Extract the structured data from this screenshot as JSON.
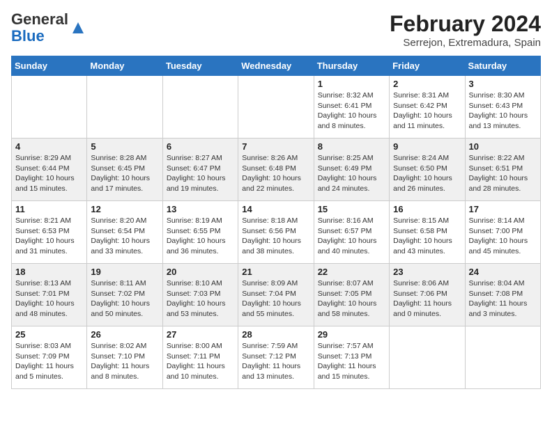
{
  "header": {
    "logo_general": "General",
    "logo_blue": "Blue",
    "month_year": "February 2024",
    "location": "Serrejon, Extremadura, Spain"
  },
  "columns": [
    "Sunday",
    "Monday",
    "Tuesday",
    "Wednesday",
    "Thursday",
    "Friday",
    "Saturday"
  ],
  "weeks": [
    [
      {
        "day": "",
        "info": ""
      },
      {
        "day": "",
        "info": ""
      },
      {
        "day": "",
        "info": ""
      },
      {
        "day": "",
        "info": ""
      },
      {
        "day": "1",
        "info": "Sunrise: 8:32 AM\nSunset: 6:41 PM\nDaylight: 10 hours\nand 8 minutes."
      },
      {
        "day": "2",
        "info": "Sunrise: 8:31 AM\nSunset: 6:42 PM\nDaylight: 10 hours\nand 11 minutes."
      },
      {
        "day": "3",
        "info": "Sunrise: 8:30 AM\nSunset: 6:43 PM\nDaylight: 10 hours\nand 13 minutes."
      }
    ],
    [
      {
        "day": "4",
        "info": "Sunrise: 8:29 AM\nSunset: 6:44 PM\nDaylight: 10 hours\nand 15 minutes."
      },
      {
        "day": "5",
        "info": "Sunrise: 8:28 AM\nSunset: 6:45 PM\nDaylight: 10 hours\nand 17 minutes."
      },
      {
        "day": "6",
        "info": "Sunrise: 8:27 AM\nSunset: 6:47 PM\nDaylight: 10 hours\nand 19 minutes."
      },
      {
        "day": "7",
        "info": "Sunrise: 8:26 AM\nSunset: 6:48 PM\nDaylight: 10 hours\nand 22 minutes."
      },
      {
        "day": "8",
        "info": "Sunrise: 8:25 AM\nSunset: 6:49 PM\nDaylight: 10 hours\nand 24 minutes."
      },
      {
        "day": "9",
        "info": "Sunrise: 8:24 AM\nSunset: 6:50 PM\nDaylight: 10 hours\nand 26 minutes."
      },
      {
        "day": "10",
        "info": "Sunrise: 8:22 AM\nSunset: 6:51 PM\nDaylight: 10 hours\nand 28 minutes."
      }
    ],
    [
      {
        "day": "11",
        "info": "Sunrise: 8:21 AM\nSunset: 6:53 PM\nDaylight: 10 hours\nand 31 minutes."
      },
      {
        "day": "12",
        "info": "Sunrise: 8:20 AM\nSunset: 6:54 PM\nDaylight: 10 hours\nand 33 minutes."
      },
      {
        "day": "13",
        "info": "Sunrise: 8:19 AM\nSunset: 6:55 PM\nDaylight: 10 hours\nand 36 minutes."
      },
      {
        "day": "14",
        "info": "Sunrise: 8:18 AM\nSunset: 6:56 PM\nDaylight: 10 hours\nand 38 minutes."
      },
      {
        "day": "15",
        "info": "Sunrise: 8:16 AM\nSunset: 6:57 PM\nDaylight: 10 hours\nand 40 minutes."
      },
      {
        "day": "16",
        "info": "Sunrise: 8:15 AM\nSunset: 6:58 PM\nDaylight: 10 hours\nand 43 minutes."
      },
      {
        "day": "17",
        "info": "Sunrise: 8:14 AM\nSunset: 7:00 PM\nDaylight: 10 hours\nand 45 minutes."
      }
    ],
    [
      {
        "day": "18",
        "info": "Sunrise: 8:13 AM\nSunset: 7:01 PM\nDaylight: 10 hours\nand 48 minutes."
      },
      {
        "day": "19",
        "info": "Sunrise: 8:11 AM\nSunset: 7:02 PM\nDaylight: 10 hours\nand 50 minutes."
      },
      {
        "day": "20",
        "info": "Sunrise: 8:10 AM\nSunset: 7:03 PM\nDaylight: 10 hours\nand 53 minutes."
      },
      {
        "day": "21",
        "info": "Sunrise: 8:09 AM\nSunset: 7:04 PM\nDaylight: 10 hours\nand 55 minutes."
      },
      {
        "day": "22",
        "info": "Sunrise: 8:07 AM\nSunset: 7:05 PM\nDaylight: 10 hours\nand 58 minutes."
      },
      {
        "day": "23",
        "info": "Sunrise: 8:06 AM\nSunset: 7:06 PM\nDaylight: 11 hours\nand 0 minutes."
      },
      {
        "day": "24",
        "info": "Sunrise: 8:04 AM\nSunset: 7:08 PM\nDaylight: 11 hours\nand 3 minutes."
      }
    ],
    [
      {
        "day": "25",
        "info": "Sunrise: 8:03 AM\nSunset: 7:09 PM\nDaylight: 11 hours\nand 5 minutes."
      },
      {
        "day": "26",
        "info": "Sunrise: 8:02 AM\nSunset: 7:10 PM\nDaylight: 11 hours\nand 8 minutes."
      },
      {
        "day": "27",
        "info": "Sunrise: 8:00 AM\nSunset: 7:11 PM\nDaylight: 11 hours\nand 10 minutes."
      },
      {
        "day": "28",
        "info": "Sunrise: 7:59 AM\nSunset: 7:12 PM\nDaylight: 11 hours\nand 13 minutes."
      },
      {
        "day": "29",
        "info": "Sunrise: 7:57 AM\nSunset: 7:13 PM\nDaylight: 11 hours\nand 15 minutes."
      },
      {
        "day": "",
        "info": ""
      },
      {
        "day": "",
        "info": ""
      }
    ]
  ]
}
